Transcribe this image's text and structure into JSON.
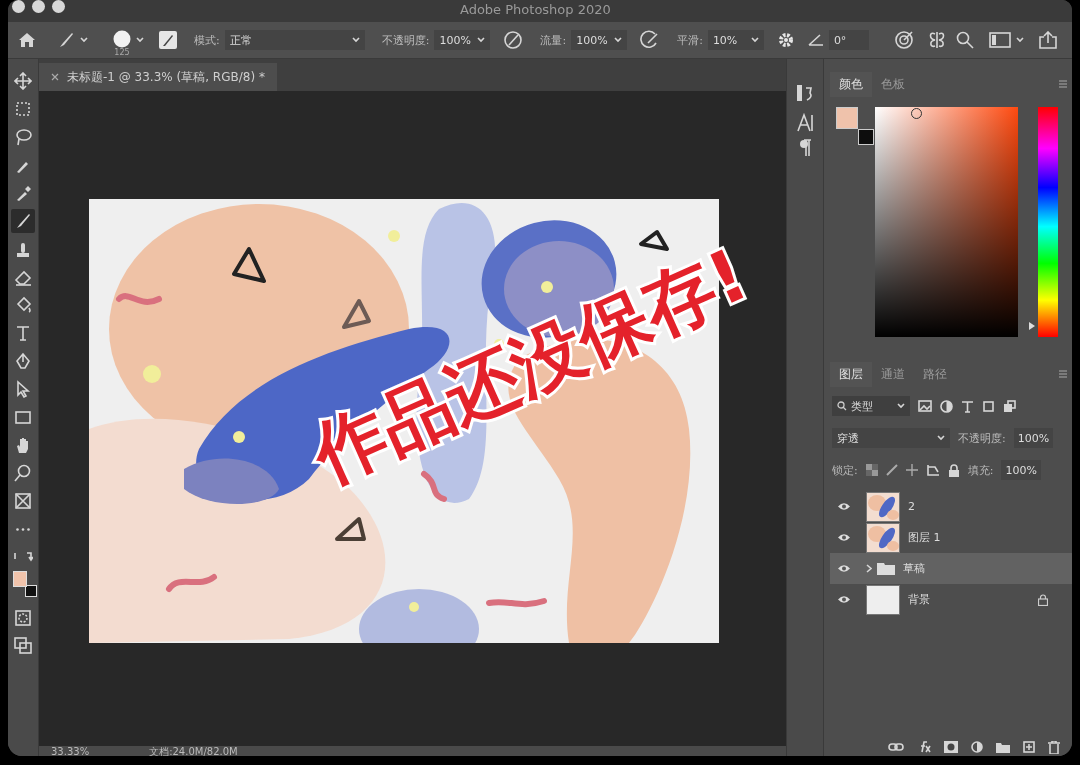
{
  "window": {
    "title": "Adobe Photoshop 2020"
  },
  "options_bar": {
    "brush_size": "125",
    "mode_label": "模式:",
    "mode_value": "正常",
    "opacity_label": "不透明度:",
    "opacity_value": "100%",
    "flow_label": "流量:",
    "flow_value": "100%",
    "smoothing_label": "平滑:",
    "smoothing_value": "10%",
    "angle_value": "0°"
  },
  "document_tab": {
    "title": "未标题-1 @ 33.3% (草稿, RGB/8) *"
  },
  "tools": [
    {
      "kind": "move",
      "selected": false
    },
    {
      "kind": "marquee",
      "selected": false
    },
    {
      "kind": "lasso",
      "selected": false
    },
    {
      "kind": "quick_select",
      "selected": false
    },
    {
      "kind": "eyedropper",
      "selected": false
    },
    {
      "kind": "brush",
      "selected": true
    },
    {
      "kind": "stamp",
      "selected": false
    },
    {
      "kind": "eraser",
      "selected": false
    },
    {
      "kind": "bucket",
      "selected": false
    },
    {
      "kind": "type",
      "selected": false
    },
    {
      "kind": "pen",
      "selected": false
    },
    {
      "kind": "path_select",
      "selected": false
    },
    {
      "kind": "rectangle",
      "selected": false
    },
    {
      "kind": "hand",
      "selected": false
    },
    {
      "kind": "zoom",
      "selected": false
    },
    {
      "kind": "frame",
      "selected": false
    },
    {
      "kind": "more",
      "selected": false
    }
  ],
  "color_panel": {
    "tabs": [
      {
        "label": "颜色",
        "selected": true
      },
      {
        "label": "色板",
        "selected": false
      }
    ],
    "hue_slider": {
      "level": 0.05
    }
  },
  "layers_panel": {
    "tabs": [
      {
        "label": "图层",
        "selected": true
      },
      {
        "label": "通道",
        "selected": false
      },
      {
        "label": "路径",
        "selected": false
      }
    ],
    "filter": "类型",
    "blend_mode": "穿透",
    "opacity_label": "不透明度:",
    "opacity_value": "100%",
    "lock_label": "锁定:",
    "fill_label": "填充:",
    "fill_value": "100%",
    "layers": [
      {
        "name": "2",
        "kind": "layer",
        "visible": true,
        "selected": false,
        "locked": false
      },
      {
        "name": "图层 1",
        "kind": "layer",
        "visible": true,
        "selected": false,
        "locked": false
      },
      {
        "name": "草稿",
        "kind": "group",
        "visible": true,
        "selected": true,
        "locked": false,
        "expanded": false
      },
      {
        "name": "背景",
        "kind": "background",
        "visible": true,
        "selected": false,
        "locked": true
      }
    ]
  },
  "status_bar": {
    "zoom": "33.33%",
    "doc_info": "文档:24.0M/82.0M"
  },
  "overlay": {
    "text": "作品还没保存!"
  }
}
